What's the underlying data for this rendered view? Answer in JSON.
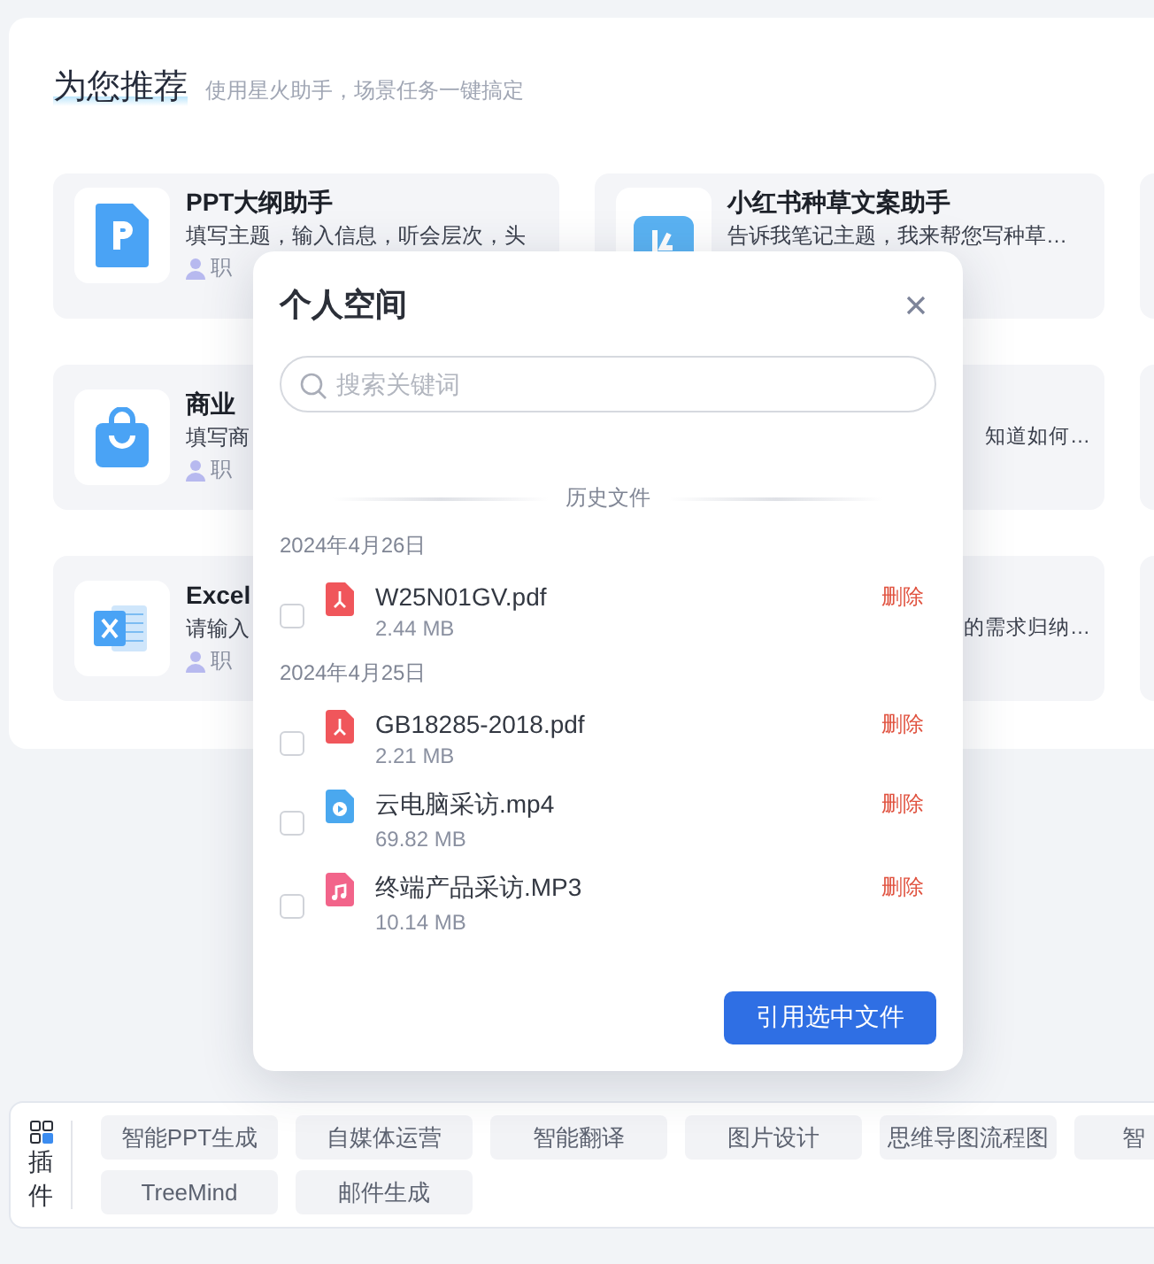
{
  "recommend": {
    "title": "为您推荐",
    "subtitle": "使用星火助手，场景任务一键搞定",
    "cards": [
      {
        "kind": "full",
        "title": "PPT大纲助手",
        "desc": "填写主题，输入信息，听会层次，头",
        "tag": "职"
      },
      {
        "kind": "full",
        "title": "小红书种草文案助手",
        "desc": "告诉我笔记主题，我来帮您写种草…"
      },
      {
        "kind": "blank"
      },
      {
        "kind": "full",
        "title": "商业",
        "desc": "填写商",
        "tag": "职"
      },
      {
        "kind": "edge",
        "desc": "知道如何…"
      },
      {
        "kind": "blank"
      },
      {
        "kind": "full",
        "title": "Excel",
        "desc": "请输入",
        "tag": "职"
      },
      {
        "kind": "edge",
        "desc": "的需求归纳…"
      },
      {
        "kind": "blank"
      }
    ]
  },
  "dialog": {
    "title": "个人空间",
    "search": {
      "placeholder": "搜索关键词"
    },
    "section": "历史文件",
    "groups": [
      {
        "date": "2024年4月26日",
        "files": [
          {
            "kind": "pdf",
            "name": "W25N01GV.pdf",
            "size": "2.44 MB",
            "checked": false,
            "action": "删除"
          }
        ]
      },
      {
        "date": "2024年4月25日",
        "files": [
          {
            "kind": "pdf",
            "name": "GB18285-2018.pdf",
            "size": "2.21 MB",
            "checked": false,
            "action": "删除"
          },
          {
            "kind": "video",
            "name": "云电脑采访.mp4",
            "size": "69.82 MB",
            "checked": false,
            "action": "删除"
          },
          {
            "kind": "audio",
            "name": "终端产品采访.MP3",
            "size": "10.14 MB",
            "checked": false,
            "action": "删除"
          }
        ]
      }
    ],
    "button": "引用选中文件"
  },
  "plugins": {
    "label": [
      "插",
      "件"
    ],
    "items": [
      "智能PPT生成",
      "自媒体运营",
      "智能翻译",
      "图片设计",
      "思维导图流程图",
      "智",
      "TreeMind",
      "邮件生成"
    ]
  }
}
